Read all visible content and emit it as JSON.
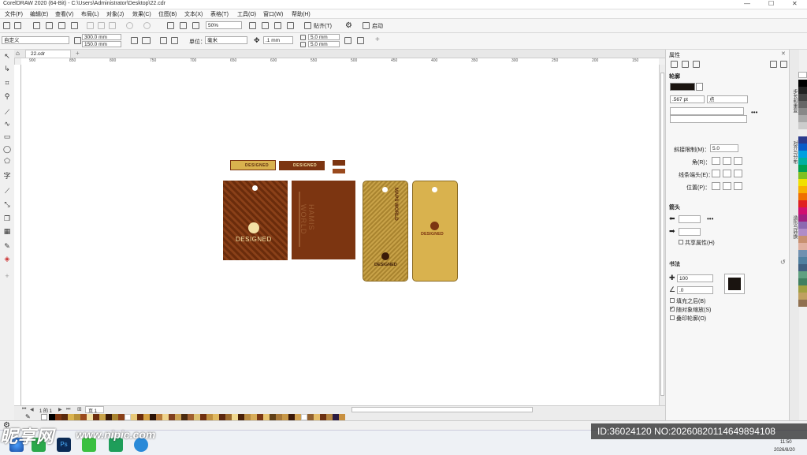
{
  "window": {
    "title": "CorelDRAW 2020 (64-Bit) - C:\\Users\\Administrator\\Desktop\\22.cdr",
    "minimize": "—",
    "maximize": "☐",
    "close": "✕"
  },
  "menu": [
    "文件(F)",
    "编辑(E)",
    "查看(V)",
    "布局(L)",
    "对象(J)",
    "效果(C)",
    "位图(B)",
    "文本(X)",
    "表格(T)",
    "工具(O)",
    "窗口(W)",
    "帮助(H)"
  ],
  "standard_toolbar": {
    "zoom": "50%",
    "snap": "贴齐(T)",
    "launch": "启动"
  },
  "property_bar": {
    "preset": "自定义",
    "width": "300.0 mm",
    "height": "150.0 mm",
    "units_label": "单位：",
    "units": "毫米",
    "nudge": ".1 mm",
    "dup_x": "5.0 mm",
    "dup_y": "5.0 mm"
  },
  "document": {
    "tab": "22.cdr",
    "page_label": "页 1",
    "page_counter": "1 的 1",
    "ruler_ticks": [
      "900",
      "850",
      "800",
      "750",
      "700",
      "650",
      "600",
      "550",
      "500",
      "450",
      "400",
      "350",
      "300",
      "250",
      "200",
      "150"
    ]
  },
  "panel": {
    "title": "属性",
    "outline_header": "轮廓",
    "width_value": ".567 pt",
    "width_unit": "点",
    "miter_label": "斜接限制(M)：",
    "miter_value": "5.0",
    "corner_label": "角(R)：",
    "cap_label": "线条端头(E)：",
    "position_label": "位置(P)：",
    "arrow_header": "箭头",
    "share_label": "共享属性(H)",
    "calligraphy_header": "书法",
    "stretch_value": "100",
    "angle_value": ".0",
    "fill_after": "填充之后(B)",
    "scale_with": "随对象缩放(S)",
    "overprint": "叠印轮廓(O)"
  },
  "side_tabs": [
    "步长和重复",
    "对齐与分布",
    "造形与转换"
  ],
  "artwork": {
    "label1": "DESIGNED",
    "label2": "DESIGNED",
    "tag1_brand": "DESIGNED",
    "tag2_text": "HAMIS WORLD",
    "tag3_top": "MAPS WORLD",
    "tag3_brand": "DESIGNED",
    "tag4_brand": "DESIGNED"
  },
  "colors": {
    "brown_dark": "#6e2f10",
    "brown": "#7c3511",
    "gold": "#d9b24e",
    "gold_dark": "#b8913a",
    "cream": "#f3e1a5"
  },
  "statusbar": {
    "time": "11:50",
    "date": "2026/8/20"
  },
  "watermark": {
    "brand": "昵享网",
    "url": "www.nipic.com",
    "id": "ID:36024120 NO:20260820114649894108"
  }
}
